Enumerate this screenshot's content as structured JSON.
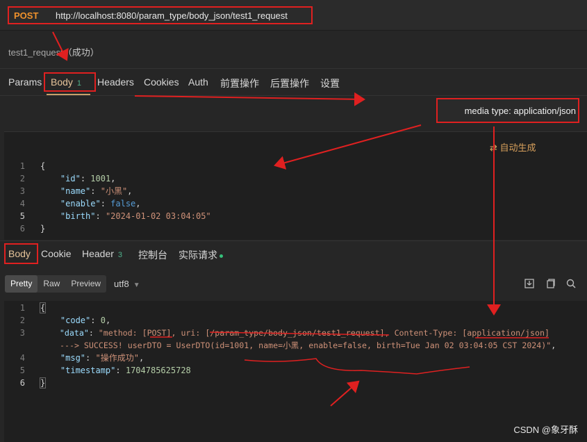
{
  "request": {
    "method": "POST",
    "url": "http://localhost:8080/param_type/body_json/test1_request",
    "name": "test1_request",
    "status": "（成功）"
  },
  "request_tabs": [
    {
      "label": "Params"
    },
    {
      "label": "Body",
      "count": "1"
    },
    {
      "label": "Headers"
    },
    {
      "label": "Cookies"
    },
    {
      "label": "Auth"
    },
    {
      "label": "前置操作"
    },
    {
      "label": "后置操作"
    },
    {
      "label": "设置"
    }
  ],
  "media_type": "media type: application/json",
  "auto_generate": "自动生成",
  "request_body": {
    "line_numbers": [
      "1",
      "2",
      "3",
      "4",
      "5",
      "6"
    ],
    "lines": [
      {
        "p1": "{"
      },
      {
        "key": "\"id\"",
        "sep": ": ",
        "num": "1001",
        "end": ","
      },
      {
        "key": "\"name\"",
        "sep": ": ",
        "str": "\"小黑\"",
        "end": ","
      },
      {
        "key": "\"enable\"",
        "sep": ": ",
        "bool": "false",
        "end": ","
      },
      {
        "key": "\"birth\"",
        "sep": ": ",
        "str": "\"2024-01-02 03:04:05\""
      },
      {
        "p1": "}"
      }
    ]
  },
  "response_tabs": [
    {
      "label": "Body"
    },
    {
      "label": "Cookie"
    },
    {
      "label": "Header",
      "count": "3"
    },
    {
      "label": "控制台"
    },
    {
      "label": "实际请求"
    }
  ],
  "view_modes": [
    "Pretty",
    "Raw",
    "Preview"
  ],
  "active_view": "Pretty",
  "encoding": "utf8",
  "response_body": {
    "line_numbers": [
      "1",
      "2",
      "3",
      "",
      "4",
      "5",
      "6"
    ],
    "l1": "{",
    "l2_key": "\"code\"",
    "l2_val": "0",
    "l3_key": "\"data\"",
    "l3_val": "\"method: [POST], uri: [/param_type/body_json/test1_request], Content-Type: [application/json]",
    "l3_cont": "---> SUCCESS! userDTO = UserDTO(id=1001, name=小黑, enable=false, birth=Tue Jan 02 03:04:05 CST 2024)\"",
    "l4_key": "\"msg\"",
    "l4_val": "\"操作成功\"",
    "l5_key": "\"timestamp\"",
    "l5_val": "1704785625728",
    "l6": "}"
  },
  "watermark": "CSDN @象牙酥",
  "colors": {
    "annotation": "#e02020",
    "method": "#f0922c",
    "accent": "#c8a06a",
    "success_dot": "#35c07a"
  }
}
